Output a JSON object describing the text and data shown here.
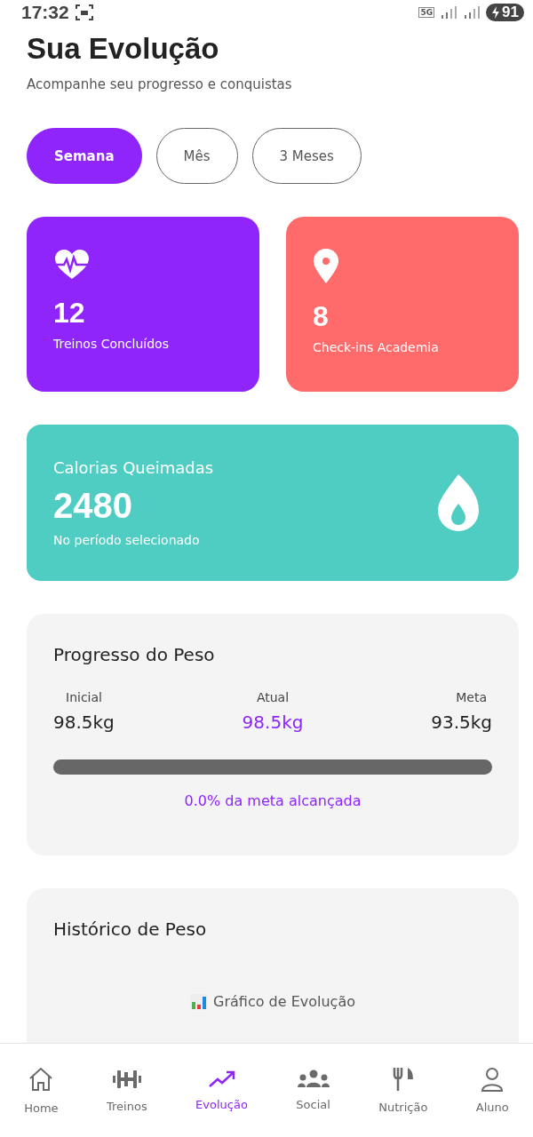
{
  "status_bar": {
    "time": "17:32",
    "network": "5G",
    "battery": "91"
  },
  "header": {
    "title": "Sua Evolução",
    "subtitle": "Acompanhe seu progresso e conquistas"
  },
  "periods": [
    {
      "label": "Semana",
      "selected": true
    },
    {
      "label": "Mês",
      "selected": false
    },
    {
      "label": "3 Meses",
      "selected": false
    }
  ],
  "stats": [
    {
      "kind": "heart",
      "value": "12",
      "label": "Treinos Concluídos",
      "color": "#8f24fb"
    },
    {
      "kind": "pin",
      "value": "8",
      "label": "Check-ins Academia",
      "color": "#fe6b6a"
    }
  ],
  "calories": {
    "title": "Calorias Queimadas",
    "value": "2480",
    "caption": "No período selecionado"
  },
  "weight_progress": {
    "title": "Progresso do Peso",
    "initial_label": "Inicial",
    "initial": "98.5kg",
    "current_label": "Atual",
    "current": "98.5kg",
    "goal_label": "Meta",
    "goal": "93.5kg",
    "level": 0,
    "caption": "0.0% da meta alcançada"
  },
  "weight_history": {
    "title": "Histórico de Peso",
    "chart_label": "Gráfico de Evolução"
  },
  "nav": [
    {
      "kind": "home",
      "label": "Home",
      "selected": false
    },
    {
      "kind": "dumbbell",
      "label": "Treinos",
      "selected": false
    },
    {
      "kind": "trend",
      "label": "Evolução",
      "selected": true
    },
    {
      "kind": "group",
      "label": "Social",
      "selected": false
    },
    {
      "kind": "food",
      "label": "Nutrição",
      "selected": false
    },
    {
      "kind": "user",
      "label": "Aluno",
      "selected": false
    }
  ]
}
